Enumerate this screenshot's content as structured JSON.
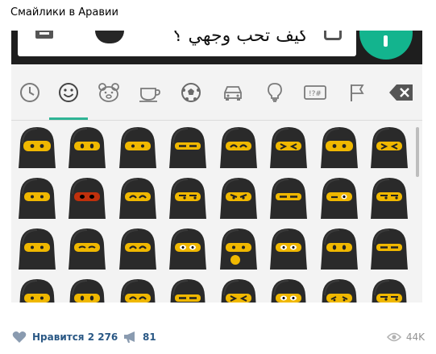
{
  "post": {
    "title": "Смайлики в Аравии"
  },
  "message_bar": {
    "text": "كيف تحب وجهي ؟",
    "mic_color": "#13b48e"
  },
  "emoji_tabs": [
    {
      "icon": "clock-icon"
    },
    {
      "icon": "smiley-icon",
      "selected": true
    },
    {
      "icon": "bear-icon"
    },
    {
      "icon": "cup-icon"
    },
    {
      "icon": "soccer-ball-icon"
    },
    {
      "icon": "car-icon"
    },
    {
      "icon": "lightbulb-icon"
    },
    {
      "icon": "symbols-icon",
      "label": "!?#"
    },
    {
      "icon": "flag-icon"
    },
    {
      "icon": "backspace-icon"
    }
  ],
  "emoji_grid": {
    "rows": [
      [
        "niqab-wide-eyes",
        "niqab-open-eyes",
        "niqab-neutral-eyes",
        "niqab-narrow-eyes",
        "niqab-happy-eyes",
        "niqab-squint-eyes",
        "niqab-wide-eyes",
        "niqab-squint-eyes"
      ],
      [
        "niqab-neutral-eyes",
        "niqab-angry-red-eyes",
        "niqab-happy-eyes",
        "niqab-sly-eyes",
        "niqab-frown-eyes",
        "niqab-narrow-eyes",
        "niqab-wink-eyes",
        "niqab-sly-eyes"
      ],
      [
        "niqab-neutral-eyes",
        "niqab-closed-eyes",
        "niqab-happy-eyes",
        "niqab-white-eyes",
        "niqab-thinking",
        "niqab-white-eyes",
        "niqab-open-eyes",
        "niqab-narrow-eyes"
      ],
      [
        "niqab-neutral-eyes",
        "niqab-open-eyes",
        "niqab-happy-eyes",
        "niqab-narrow-eyes",
        "niqab-squint-eyes",
        "niqab-white-eyes",
        "niqab-sad-eyes",
        "niqab-sly-eyes"
      ]
    ]
  },
  "footer": {
    "like_label": "Нравится",
    "like_count": "2 276",
    "repost_count": "81",
    "views": "44K"
  }
}
